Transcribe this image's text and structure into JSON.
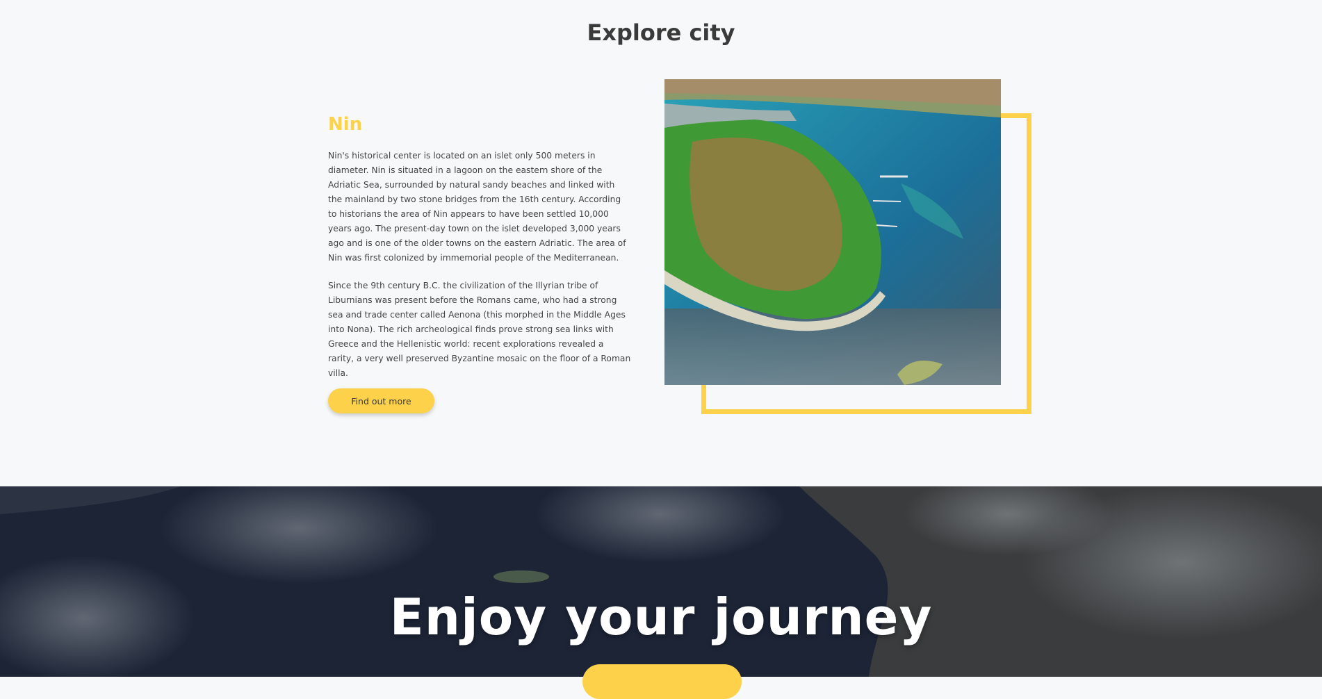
{
  "section": {
    "title": "Explore city"
  },
  "city": {
    "name": "Nin",
    "paragraphs": [
      "Nin's historical center is located on an islet only 500 meters in diameter. Nin is situated in a lagoon on the eastern shore of the Adriatic Sea, surrounded by natural sandy beaches and linked with the mainland by two stone bridges from the 16th century. According to historians the area of Nin appears to have been settled 10,000 years ago. The present-day town on the islet developed 3,000 years ago and is one of the older towns on the eastern Adriatic. The area of Nin was first colonized by immemorial people of the Mediterranean.",
      "Since the 9th century B.C. the civilization of the Illyrian tribe of Liburnians was present before the Romans came, who had a strong sea and trade center called Aenona (this morphed in the Middle Ages into Nona). The rich archeological finds prove strong sea links with Greece and the Hellenistic world: recent explorations revealed a rarity, a very well preserved Byzantine mosaic on the floor of a Roman villa."
    ],
    "cta_label": "Find out more"
  },
  "hero": {
    "title": "Enjoy your journey"
  },
  "colors": {
    "accent": "#fdd24a",
    "title": "#3a3a3a",
    "hero_overlay": "#1b2233"
  }
}
